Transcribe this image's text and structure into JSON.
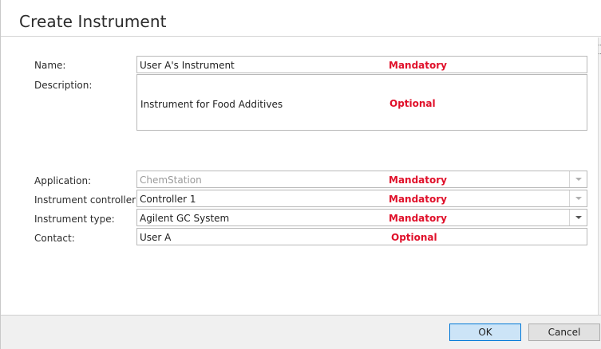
{
  "dialog": {
    "title": "Create Instrument"
  },
  "form": {
    "name": {
      "label": "Name:",
      "value": "User A's Instrument",
      "hint": "Mandatory"
    },
    "description": {
      "label": "Description:",
      "value": "Instrument for Food Additives",
      "hint": "Optional"
    },
    "application": {
      "label": "Application:",
      "value": "ChemStation",
      "hint": "Mandatory",
      "enabled": false
    },
    "controller": {
      "label": "Instrument controller:",
      "value": "Controller 1",
      "hint": "Mandatory",
      "enabled": false
    },
    "instrument_type": {
      "label": "Instrument type:",
      "value": "Agilent GC System",
      "hint": "Mandatory",
      "enabled": true
    },
    "contact": {
      "label": "Contact:",
      "value": "User A",
      "hint": "Optional"
    }
  },
  "buttons": {
    "ok": "OK",
    "cancel": "Cancel"
  },
  "colors": {
    "hint": "#e0102a",
    "ok_button_bg": "#cce4f7",
    "ok_button_border": "#0078d7",
    "disabled_text": "#9a9a9a"
  },
  "icons": {
    "dropdown": "chevron-down-icon",
    "scroll_grip": "grip-icon"
  }
}
